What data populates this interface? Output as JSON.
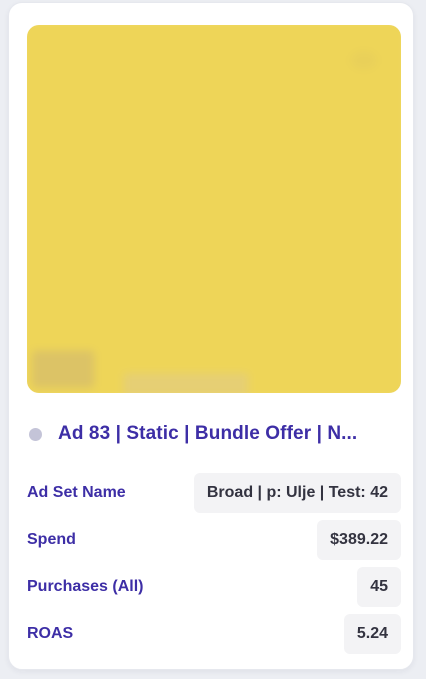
{
  "ad": {
    "title": "Ad 83 | Static | Bundle Offer | N...",
    "thumbnail_alt": "blurred-ad-creative",
    "status": "inactive"
  },
  "metrics": [
    {
      "label": "Ad Set Name",
      "value": "Broad | p: Ulje | Test: 42"
    },
    {
      "label": "Spend",
      "value": "$389.22"
    },
    {
      "label": "Purchases (All)",
      "value": "45"
    },
    {
      "label": "ROAS",
      "value": "5.24"
    }
  ],
  "colors": {
    "accent": "#3d2ea6",
    "thumbnail": "#eed558",
    "status_dot": "#c4c4d8",
    "value_bg": "#f3f3f5"
  }
}
